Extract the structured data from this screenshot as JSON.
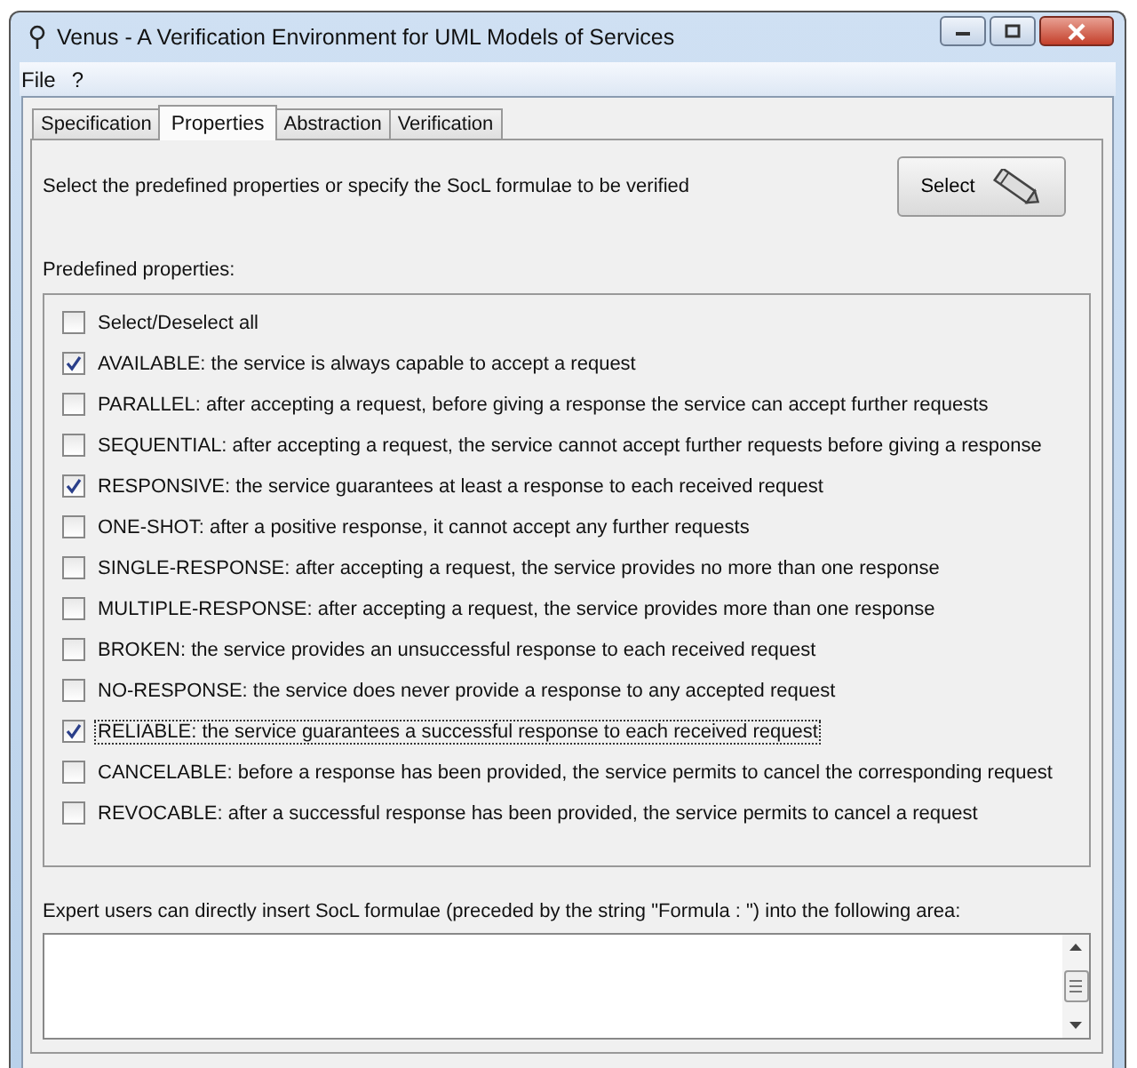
{
  "window": {
    "title": "Venus - A Verification Environment for UML Models of Services"
  },
  "menu": [
    "File",
    "?"
  ],
  "tabs": [
    {
      "label": "Specification",
      "selected": false
    },
    {
      "label": "Properties",
      "selected": true
    },
    {
      "label": "Abstraction",
      "selected": false
    },
    {
      "label": "Verification",
      "selected": false
    }
  ],
  "instruction": "Select the predefined properties or specify the SocL formulae to be verified",
  "select_button": "Select",
  "predefined_label": "Predefined properties:",
  "properties": [
    {
      "label": "Select/Deselect all",
      "checked": false,
      "focused": false
    },
    {
      "label": "AVAILABLE: the service is always capable to accept a request",
      "checked": true,
      "focused": false
    },
    {
      "label": "PARALLEL: after accepting a request, before giving a response the service can accept further requests",
      "checked": false,
      "focused": false
    },
    {
      "label": "SEQUENTIAL: after accepting a request, the service cannot accept further requests before giving a response",
      "checked": false,
      "focused": false
    },
    {
      "label": "RESPONSIVE: the service guarantees at least a response to each received request",
      "checked": true,
      "focused": false
    },
    {
      "label": "ONE-SHOT: after a positive response, it cannot accept any further requests",
      "checked": false,
      "focused": false
    },
    {
      "label": "SINGLE-RESPONSE: after accepting a request, the service provides no more than one response",
      "checked": false,
      "focused": false
    },
    {
      "label": "MULTIPLE-RESPONSE: after accepting a request, the service provides more than one response",
      "checked": false,
      "focused": false
    },
    {
      "label": "BROKEN: the service provides an unsuccessful response to each received request",
      "checked": false,
      "focused": false
    },
    {
      "label": "NO-RESPONSE: the service does never provide a response to any accepted request",
      "checked": false,
      "focused": false
    },
    {
      "label": "RELIABLE: the service guarantees a successful response to each received request",
      "checked": true,
      "focused": true
    },
    {
      "label": "CANCELABLE: before a response has been provided, the service permits to cancel the corresponding request",
      "checked": false,
      "focused": false
    },
    {
      "label": "REVOCABLE: after a successful response has been provided, the service permits to cancel a request",
      "checked": false,
      "focused": false
    }
  ],
  "expert_label": "Expert users can directly insert SocL formulae (preceded by the string \"Formula : \") into the following area:"
}
